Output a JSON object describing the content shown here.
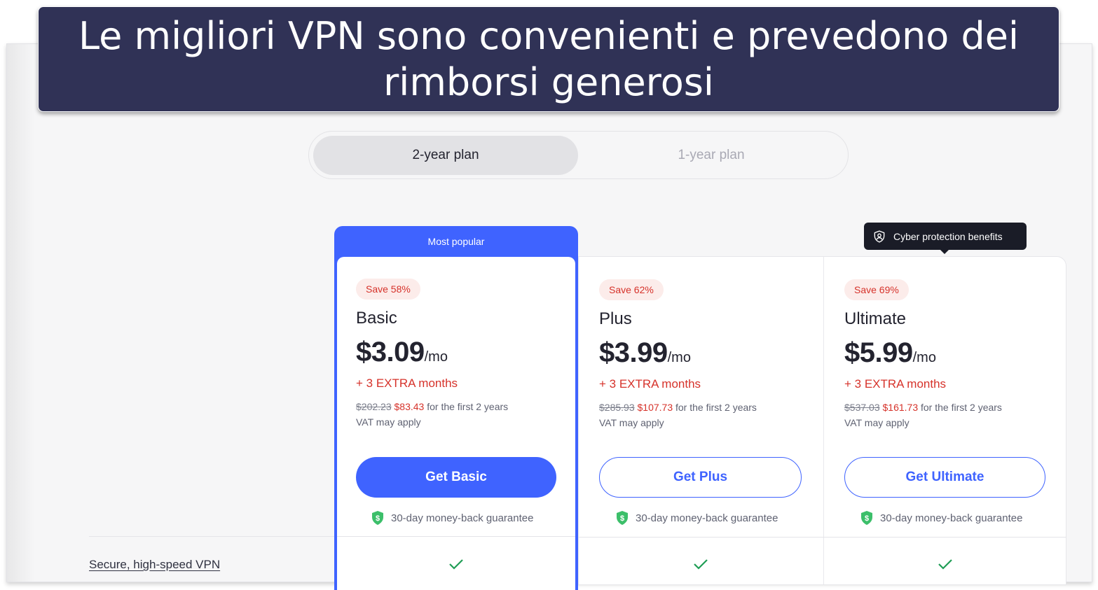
{
  "banner": {
    "title": "Le migliori VPN sono convenienti e prevedono dei rimborsi generosi"
  },
  "plan_toggle": {
    "options": [
      {
        "label": "2-year plan",
        "selected": true
      },
      {
        "label": "1-year plan",
        "selected": false
      }
    ]
  },
  "tooltip": {
    "icon": "shield-user-icon",
    "text": "Cyber protection benefits"
  },
  "plans": [
    {
      "ribbon": "Most popular",
      "badge": "Save 58%",
      "name": "Basic",
      "price": "$3.09",
      "per": "/mo",
      "extra": "+ 3 EXTRA months",
      "old_total": "$202.23",
      "new_total": "$83.43",
      "total_suffix": " for the first 2 years",
      "vat": "VAT may apply",
      "button": "Get Basic",
      "guarantee": "30-day money-back guarantee"
    },
    {
      "badge": "Save 62%",
      "name": "Plus",
      "price": "$3.99",
      "per": "/mo",
      "extra": "+ 3 EXTRA months",
      "old_total": "$285.93",
      "new_total": "$107.73",
      "total_suffix": " for the first 2 years",
      "vat": "VAT may apply",
      "button": "Get Plus",
      "guarantee": "30-day money-back guarantee"
    },
    {
      "badge": "Save 69%",
      "name": "Ultimate",
      "price": "$5.99",
      "per": "/mo",
      "extra": "+ 3 EXTRA months",
      "old_total": "$537.03",
      "new_total": "$161.73",
      "total_suffix": " for the first 2 years",
      "vat": "VAT may apply",
      "button": "Get Ultimate",
      "guarantee": "30-day money-back guarantee"
    }
  ],
  "features": [
    {
      "label": "Secure, high-speed VPN",
      "basic": true,
      "plus": true,
      "ultimate": true
    }
  ],
  "colors": {
    "accent": "#3f63ff",
    "banner": "#303256",
    "sale_red": "#d6322a",
    "check_green": "#1f9d55",
    "guarantee_green": "#3cbf6a"
  }
}
